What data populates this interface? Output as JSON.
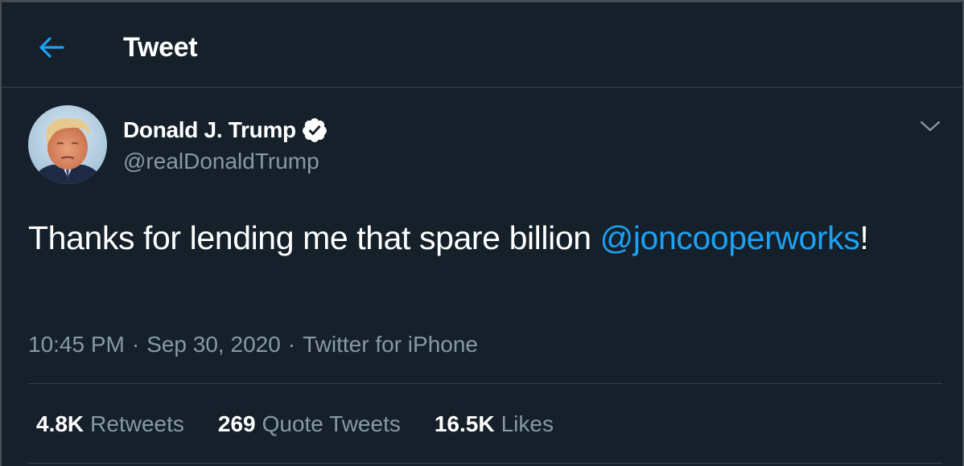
{
  "header": {
    "title": "Tweet",
    "back_icon": "arrow-left-icon",
    "accent_color": "#1da1f2"
  },
  "author": {
    "display_name": "Donald J. Trump",
    "handle": "@realDonaldTrump",
    "verified": true,
    "verified_icon": "verified-badge-icon"
  },
  "tweet": {
    "text_before": "Thanks for lending me that spare billion ",
    "mention": "@joncooperworks",
    "text_after": "!",
    "time": "10:45 PM",
    "date": "Sep 30, 2020",
    "source": "Twitter for iPhone",
    "separator": "·"
  },
  "stats": [
    {
      "count": "4.8K",
      "label": "Retweets"
    },
    {
      "count": "269",
      "label": "Quote Tweets"
    },
    {
      "count": "16.5K",
      "label": "Likes"
    }
  ],
  "colors": {
    "background": "#15202b",
    "border": "#38444d",
    "secondary_text": "#8899a6",
    "primary_text": "#ffffff",
    "link": "#1da1f2"
  }
}
